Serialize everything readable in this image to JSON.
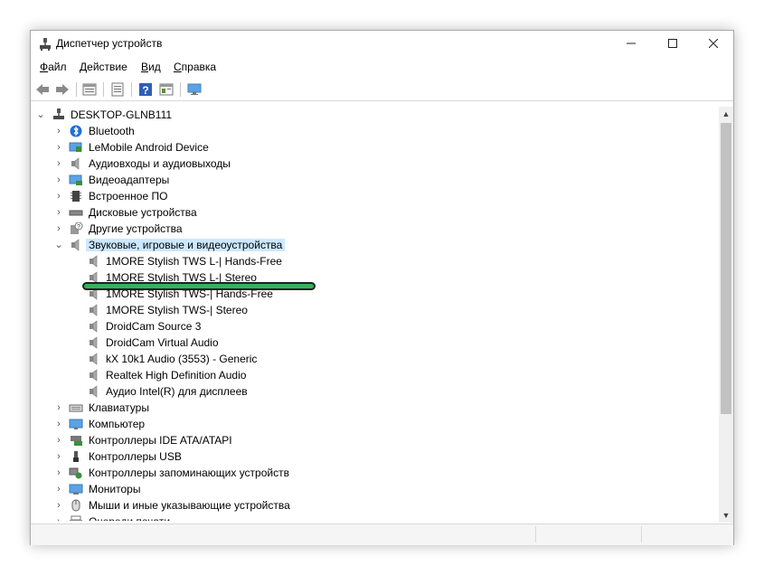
{
  "window": {
    "title": "Диспетчер устройств",
    "controls": {
      "minimize": "—",
      "maximize": "☐",
      "close": "✕"
    }
  },
  "menu": [
    {
      "first": "Ф",
      "rest": "айл"
    },
    {
      "first": "Д",
      "rest": "ействие"
    },
    {
      "first": "В",
      "rest": "ид"
    },
    {
      "first": "С",
      "rest": "правка"
    }
  ],
  "toolbar": [
    "back-icon",
    "forward-icon",
    "properties-view-icon",
    "list-view-icon",
    "help-icon",
    "details-view-icon",
    "monitor-icon"
  ],
  "tree": {
    "root": "DESKTOP-GLNB111",
    "categories": [
      {
        "label": "Bluetooth",
        "icon": "bluetooth-icon"
      },
      {
        "label": "LeMobile Android Device",
        "icon": "android-device-icon"
      },
      {
        "label": "Аудиовходы и аудиовыходы",
        "icon": "speaker-icon"
      },
      {
        "label": "Видеоадаптеры",
        "icon": "display-adapter-icon"
      },
      {
        "label": "Встроенное ПО",
        "icon": "firmware-icon"
      },
      {
        "label": "Дисковые устройства",
        "icon": "disk-icon"
      },
      {
        "label": "Другие устройства",
        "icon": "unknown-device-icon"
      },
      {
        "label": "Звуковые, игровые и видеоустройства",
        "icon": "speaker-icon",
        "expanded": true,
        "selected": true
      }
    ],
    "sound_devices": [
      "1MORE Stylish TWS L-| Hands-Free",
      "1MORE Stylish TWS L-| Stereo",
      "1MORE Stylish TWS-| Hands-Free",
      "1MORE Stylish TWS-| Stereo",
      "DroidCam Source 3",
      "DroidCam Virtual Audio",
      "kX 10k1 Audio (3553) - Generic",
      "Realtek High Definition Audio",
      "Аудио Intel(R) для дисплеев"
    ],
    "categories_after": [
      {
        "label": "Клавиатуры",
        "icon": "keyboard-icon"
      },
      {
        "label": "Компьютер",
        "icon": "computer-icon"
      },
      {
        "label": "Контроллеры IDE ATA/ATAPI",
        "icon": "ide-controller-icon"
      },
      {
        "label": "Контроллеры USB",
        "icon": "usb-icon"
      },
      {
        "label": "Контроллеры запоминающих устройств",
        "icon": "storage-controller-icon"
      },
      {
        "label": "Мониторы",
        "icon": "monitor-icon"
      },
      {
        "label": "Мыши и иные указывающие устройства",
        "icon": "mouse-icon"
      },
      {
        "label": "Очереди печати",
        "icon": "printer-icon"
      }
    ]
  },
  "scrollbar": {
    "up": "▲",
    "down": "▼"
  },
  "colors": {
    "selection": "#cce8ff",
    "highlight_marker": "#36b35a",
    "window_border": "#aaaaaa"
  }
}
